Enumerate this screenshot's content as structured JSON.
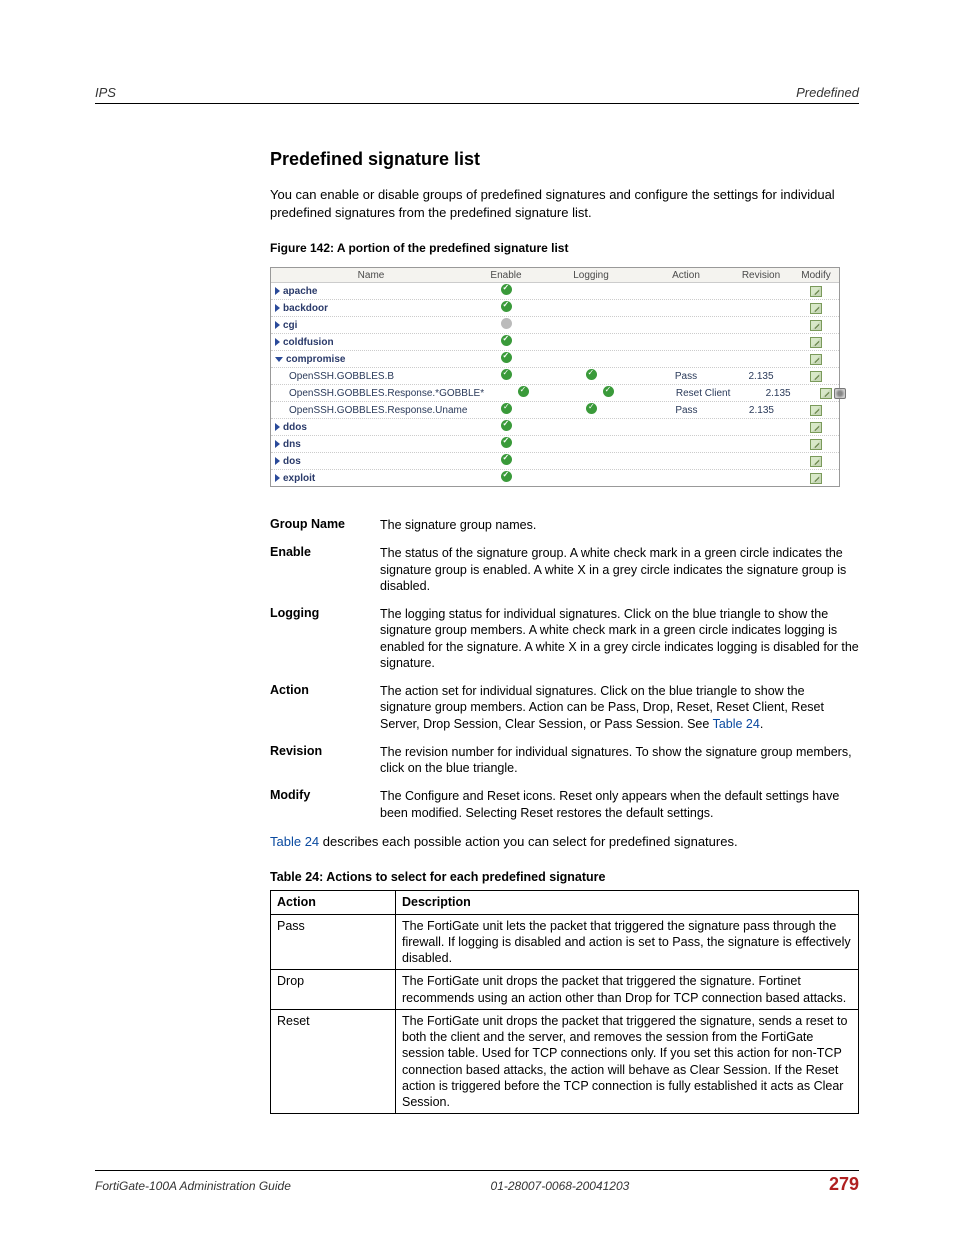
{
  "header": {
    "left": "IPS",
    "right": "Predefined"
  },
  "section": {
    "title": "Predefined signature list",
    "intro": "You can enable or disable groups of predefined signatures and configure the settings for individual predefined signatures from the predefined signature list.",
    "figure_caption": "Figure 142: A portion of the predefined signature list"
  },
  "shot": {
    "headers": {
      "name": "Name",
      "enable": "Enable",
      "logging": "Logging",
      "action": "Action",
      "revision": "Revision",
      "modify": "Modify"
    },
    "rows": [
      {
        "type": "group",
        "name": "apache",
        "enable": "check"
      },
      {
        "type": "group",
        "name": "backdoor",
        "enable": "check"
      },
      {
        "type": "group",
        "name": "cgi",
        "enable": "grey"
      },
      {
        "type": "group",
        "name": "coldfusion",
        "enable": "check"
      },
      {
        "type": "group-open",
        "name": "compromise",
        "enable": "check"
      },
      {
        "type": "sub",
        "name": "OpenSSH.GOBBLES.B",
        "enable": "check",
        "logging": "check",
        "action": "Pass",
        "revision": "2.135",
        "modify": "edit"
      },
      {
        "type": "sub",
        "name": "OpenSSH.GOBBLES.Response.*GOBBLE*",
        "enable": "check",
        "logging": "check",
        "action": "Reset Client",
        "revision": "2.135",
        "modify": "edit-reset"
      },
      {
        "type": "sub",
        "name": "OpenSSH.GOBBLES.Response.Uname",
        "enable": "check",
        "logging": "check",
        "action": "Pass",
        "revision": "2.135",
        "modify": "edit"
      },
      {
        "type": "group",
        "name": "ddos",
        "enable": "check"
      },
      {
        "type": "group",
        "name": "dns",
        "enable": "check"
      },
      {
        "type": "group",
        "name": "dos",
        "enable": "check"
      },
      {
        "type": "group",
        "name": "exploit",
        "enable": "check"
      }
    ]
  },
  "defs": [
    {
      "term": "Group Name",
      "desc": "The signature group names."
    },
    {
      "term": "Enable",
      "desc": "The status of the signature group. A white check mark in a green circle indicates the signature group is enabled. A white X in a grey circle indicates the signature group is disabled."
    },
    {
      "term": "Logging",
      "desc": "The logging status for individual signatures. Click on the blue triangle to show the signature group members. A white check mark in a green circle indicates logging is enabled for the signature. A white X in a grey circle indicates logging is disabled for the signature."
    },
    {
      "term": "Action",
      "desc_pre": "The action set for individual signatures. Click on the blue triangle to show the signature group members. Action can be Pass, Drop, Reset, Reset Client, Reset Server, Drop Session, Clear Session, or Pass Session. See ",
      "link": "Table 24",
      "desc_post": "."
    },
    {
      "term": "Revision",
      "desc": "The revision number for individual signatures. To show the signature group members, click on the blue triangle."
    },
    {
      "term": "Modify",
      "desc": "The Configure and Reset icons. Reset only appears when the default settings have been modified. Selecting Reset restores the default settings."
    }
  ],
  "after_defs_pre": "",
  "after_defs_link": "Table 24",
  "after_defs_post": " describes each possible action you can select for predefined signatures.",
  "table24": {
    "caption": "Table 24: Actions to select for each predefined signature",
    "head_action": "Action",
    "head_desc": "Description",
    "rows": [
      {
        "action": "Pass",
        "desc": "The FortiGate unit lets the packet that triggered the signature pass through the firewall. If logging is disabled and action is set to Pass, the signature is effectively disabled."
      },
      {
        "action": "Drop",
        "desc": "The FortiGate unit drops the packet that triggered the signature. Fortinet recommends using an action other than Drop for TCP connection based attacks."
      },
      {
        "action": "Reset",
        "desc": "The FortiGate unit drops the packet that triggered the signature, sends a reset to both the client and the server, and removes the session from the FortiGate session table. Used for TCP connections only. If you set this action for non-TCP connection based attacks, the action will behave as Clear Session. If the Reset action is triggered before the TCP connection is fully established it acts as Clear Session."
      }
    ]
  },
  "footer": {
    "left": "FortiGate-100A Administration Guide",
    "mid": "01-28007-0068-20041203",
    "page": "279"
  }
}
